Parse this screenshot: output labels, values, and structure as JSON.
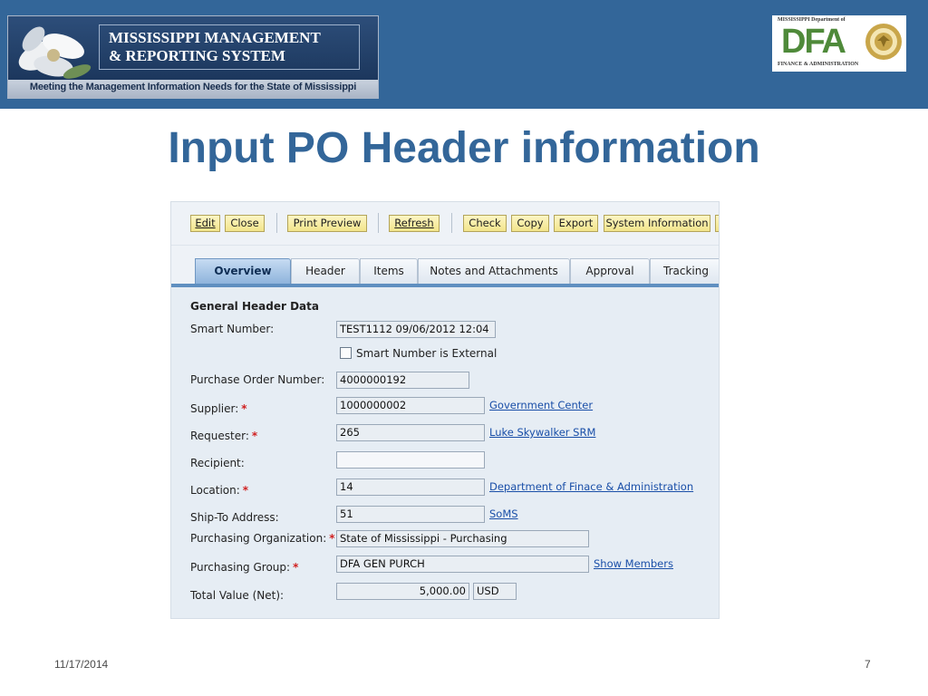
{
  "logo": {
    "title_line1": "MISSISSIPPI MANAGEMENT",
    "title_line2": "& REPORTING SYSTEM",
    "tagline": "Meeting the Management Information Needs for the State of Mississippi"
  },
  "dfa_logo": {
    "top_text": "MISSISSIPPI Department of",
    "letters": "DFA",
    "bottom_text": "FINANCE & ADMINISTRATION"
  },
  "slide": {
    "title": "Input PO Header information",
    "date": "11/17/2014",
    "page": "7"
  },
  "toolbar": {
    "buttons": [
      "Edit",
      "Close",
      "Print Preview",
      "Refresh",
      "Check",
      "Copy",
      "Export",
      "System Information"
    ]
  },
  "tabs": [
    "Overview",
    "Header",
    "Items",
    "Notes and Attachments",
    "Approval",
    "Tracking"
  ],
  "form": {
    "section_title": "General Header Data",
    "smart_number_label": "Smart Number:",
    "smart_number_value": "TEST1112 09/06/2012 12:04",
    "smart_external_label": "Smart Number is External",
    "po_number_label": "Purchase Order Number:",
    "po_number_value": "4000000192",
    "supplier_label": "Supplier:",
    "supplier_value": "1000000002",
    "supplier_link": "Government Center",
    "requester_label": "Requester:",
    "requester_value": "265",
    "requester_link": "Luke Skywalker SRM",
    "recipient_label": "Recipient:",
    "recipient_value": "",
    "location_label": "Location:",
    "location_value": "14",
    "location_link": "Department of Finace & Administration",
    "shipto_label": "Ship-To Address:",
    "shipto_value": "51",
    "shipto_link": "SoMS",
    "purch_org_label": "Purchasing Organization:",
    "purch_org_value": "State of Mississippi - Purchasing",
    "purch_group_label": "Purchasing Group:",
    "purch_group_value": "DFA GEN PURCH",
    "purch_group_link": "Show Members",
    "total_label": "Total Value (Net):",
    "total_value": "5,000.00",
    "currency": "USD",
    "required_marker": "*"
  }
}
